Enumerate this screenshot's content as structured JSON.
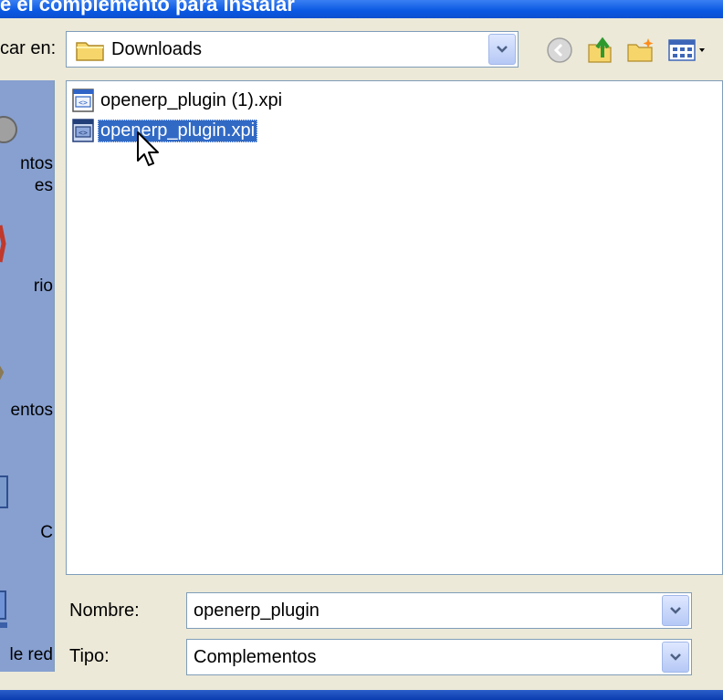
{
  "window": {
    "title": "e el complemento para instalar"
  },
  "lookin": {
    "label": "car en:",
    "value": "Downloads"
  },
  "toolbar": {
    "icons": [
      "back-icon",
      "up-folder-icon",
      "new-folder-icon",
      "view-menu-icon"
    ]
  },
  "places": {
    "items": [
      {
        "label": "ntos\nes",
        "icon": "documents-icon"
      },
      {
        "label": "rio",
        "icon": "desktop-icon"
      },
      {
        "label": "entos",
        "icon": "my-documents-icon"
      },
      {
        "label": "C",
        "icon": "my-computer-icon"
      },
      {
        "label": "le red",
        "icon": "network-places-icon"
      }
    ]
  },
  "files": {
    "items": [
      {
        "name": "openerp_plugin (1).xpi",
        "selected": false
      },
      {
        "name": "openerp_plugin.xpi",
        "selected": true
      }
    ]
  },
  "filename": {
    "label": "Nombre:",
    "value": "openerp_plugin"
  },
  "filetype": {
    "label": "Tipo:",
    "value": "Complementos"
  },
  "colors": {
    "selection": "#316ac5",
    "titlebar": "#0a58e2",
    "border": "#7f9db9"
  }
}
